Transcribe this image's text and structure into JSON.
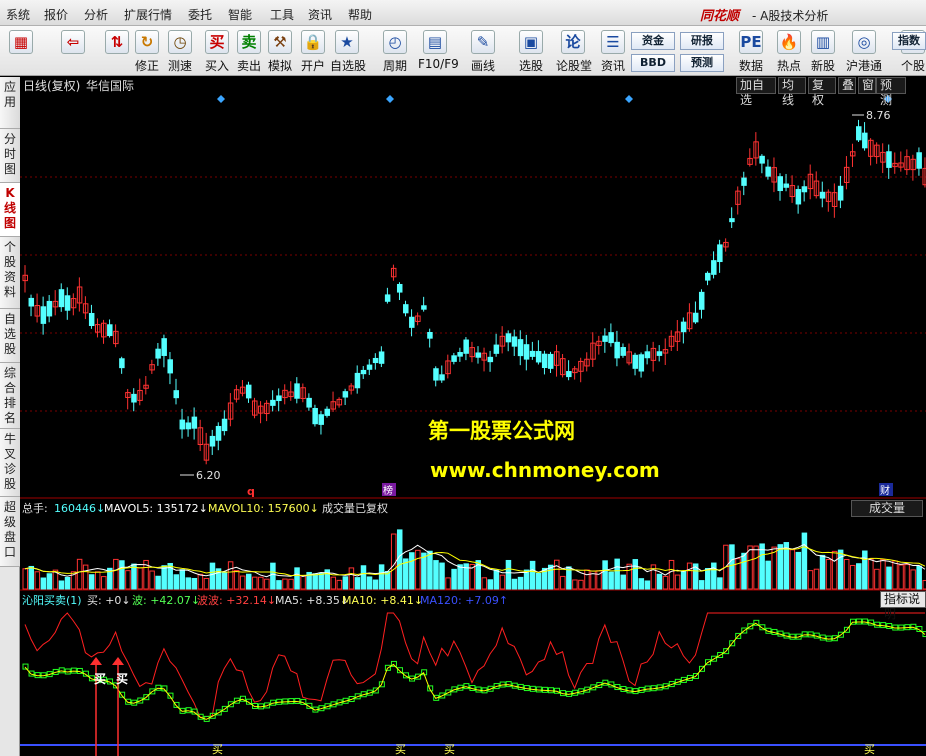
{
  "menubar": {
    "items": [
      "系统",
      "报价",
      "分析",
      "扩展行情",
      "委托",
      "智能",
      "工具",
      "资讯",
      "帮助"
    ],
    "brand": "同花顺",
    "app_title": "- A股技术分析"
  },
  "toolbar": {
    "buttons": [
      {
        "label": "",
        "icon": "colorful-grid-icon"
      },
      {
        "label": "",
        "icon": "back-arrow-icon"
      },
      {
        "label": "",
        "icon": "up-down-arrow-icon"
      },
      {
        "label": "修正",
        "icon": "refresh-icon"
      },
      {
        "label": "测速",
        "icon": "clock-icon"
      },
      {
        "label": "买入",
        "icon": "buy-icon",
        "glyph": "买"
      },
      {
        "label": "卖出",
        "icon": "sell-icon",
        "glyph": "卖"
      },
      {
        "label": "模拟",
        "icon": "hammer-icon"
      },
      {
        "label": "开户",
        "icon": "lock-icon"
      },
      {
        "label": "自选股",
        "icon": "star-icon"
      },
      {
        "label": "周期",
        "icon": "period-clock-icon"
      },
      {
        "label": "F10/F9",
        "icon": "f10-icon"
      },
      {
        "label": "画线",
        "icon": "pencil-icon"
      },
      {
        "label": "选股",
        "icon": "stock-screen-icon"
      },
      {
        "label": "论股堂",
        "icon": "discussion-icon",
        "glyph": "论"
      },
      {
        "label": "资讯",
        "icon": "news-icon"
      },
      {
        "label": "数据",
        "icon": "pe-data-icon",
        "glyph": "PE"
      },
      {
        "label": "热点",
        "icon": "hot-icon"
      },
      {
        "label": "新股",
        "icon": "new-stock-icon"
      },
      {
        "label": "沪港通",
        "icon": "sse-hkex-icon"
      },
      {
        "label": "个股",
        "icon": "index-icon"
      }
    ],
    "small_buttons": [
      "资金",
      "BBD",
      "研报",
      "预测"
    ],
    "index_button": "指数"
  },
  "sidebar": {
    "items": [
      "应用",
      "分时图",
      "K线图",
      "个股资料",
      "自选股",
      "综合排名",
      "牛叉诊股",
      "超级盘口"
    ],
    "active": 2
  },
  "kline_panel": {
    "title": "日线(复权)",
    "stock_name": "华信国际",
    "tags": [
      "加自选",
      "均线",
      "复权",
      "叠",
      "窗",
      "预测"
    ],
    "high_label": "8.76",
    "low_label": "6.20",
    "watermark_title": "第一股票公式网",
    "watermark_url": "www.chnmoney.com",
    "event_markers": [
      "q",
      "榜",
      "财"
    ]
  },
  "volume_panel": {
    "total_label": "总手:",
    "total_value": "160446↓",
    "mavol5": "MAVOL5: 135172↓",
    "mavol10": "MAVOL10: 157600↓",
    "note": "成交量已复权",
    "name": "成交量"
  },
  "indicator_panel": {
    "name": "沁阳买卖(1)",
    "buy_label": "买: +0↓",
    "wave_label": "波: +42.07↓",
    "wave2_label": "波波: +32.14↓",
    "ma5_label": "MA5: +8.35↓",
    "ma10_label": "MA10: +8.41↓",
    "ma120_label": "MA120: +7.09↑",
    "help": "指标说明",
    "signals": [
      "买",
      "买"
    ],
    "bottom_signals": [
      "买",
      "买",
      "买",
      "买"
    ]
  },
  "colors": {
    "up": "#ff3232",
    "down": "#54ffff",
    "ma5": "#ffffff",
    "ma10": "#ffff00",
    "wave": "#ff2020",
    "ma_green": "#22ff22",
    "label_white": "#e0e0e0",
    "label_yellow": "#ffff54",
    "label_cyan": "#54ffff"
  }
}
